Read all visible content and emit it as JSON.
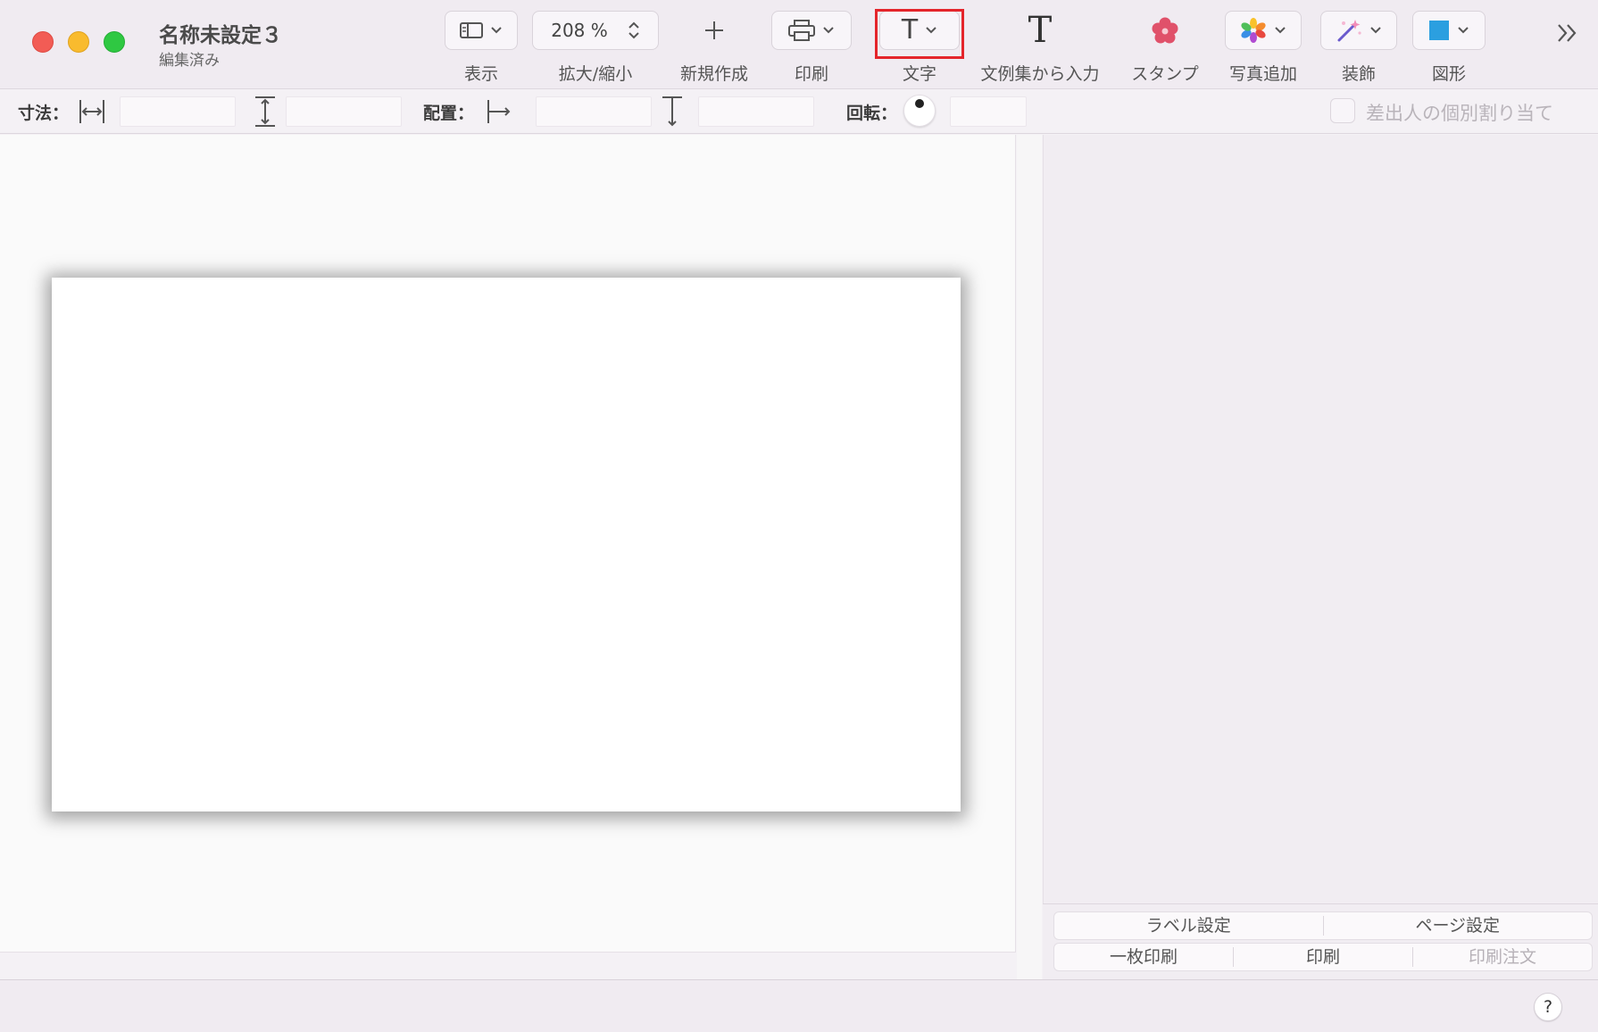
{
  "window": {
    "title": "名称未設定３",
    "subtitle": "編集済み"
  },
  "toolbar": {
    "view": {
      "label": "表示",
      "icon": "sidebar-layout-icon"
    },
    "zoom": {
      "label": "拡大/縮小",
      "value": "208 %"
    },
    "new": {
      "label": "新規作成",
      "icon": "plus-icon"
    },
    "print": {
      "label": "印刷",
      "icon": "printer-icon"
    },
    "text": {
      "label": "文字",
      "glyph": "T",
      "highlighted": true
    },
    "phrase": {
      "label": "文例集から入力",
      "glyph": "T"
    },
    "stamp": {
      "label": "スタンプ",
      "icon": "flower-stamp-icon"
    },
    "photo": {
      "label": "写真追加",
      "icon": "photos-icon"
    },
    "decor": {
      "label": "装飾",
      "icon": "magic-wand-icon"
    },
    "shape": {
      "label": "図形",
      "icon": "square-shape-icon"
    }
  },
  "propbar": {
    "size_label": "寸法：",
    "position_label": "配置：",
    "rotate_label": "回転：",
    "individual_checkbox_label": "差出人の個別割り当て"
  },
  "panel": {
    "label_settings": "ラベル設定",
    "page_settings": "ページ設定",
    "single_print": "一枚印刷",
    "print": "印刷",
    "print_order": "印刷注文"
  },
  "status": {
    "help": "?"
  },
  "colors": {
    "highlight": "#e4252b",
    "stamp": "#e0516a",
    "shape": "#2b9fe0"
  }
}
